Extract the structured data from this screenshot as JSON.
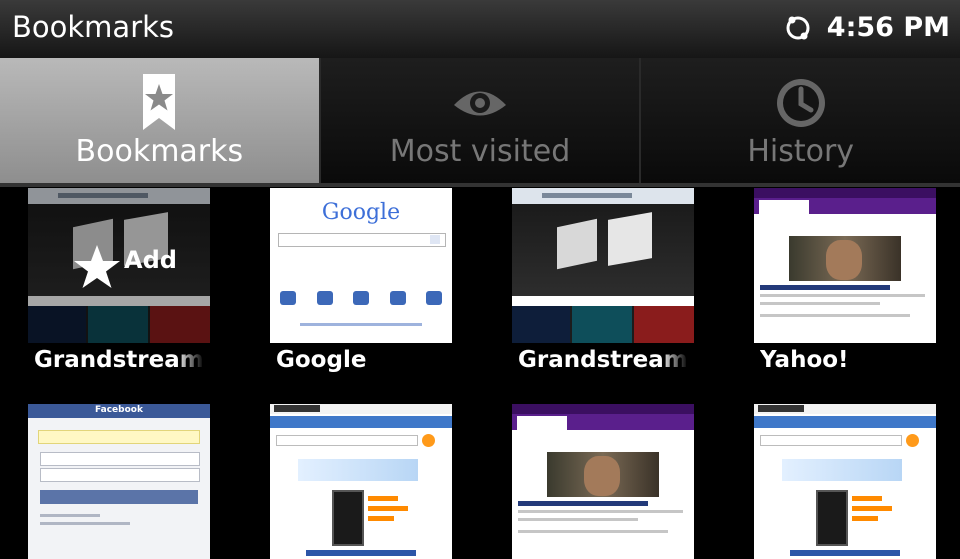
{
  "status_bar": {
    "title": "Bookmarks",
    "time": "4:56 PM",
    "sync_icon": "sync-icon"
  },
  "tabs": [
    {
      "label": "Bookmarks",
      "icon": "bookmark-star-icon",
      "selected": true
    },
    {
      "label": "Most visited",
      "icon": "eye-icon",
      "selected": false
    },
    {
      "label": "History",
      "icon": "clock-icon",
      "selected": false
    }
  ],
  "add_label": "Add",
  "bookmarks": [
    {
      "title": "Grandstream Networks",
      "thumb": "grandstream"
    },
    {
      "title": "Google",
      "thumb": "google",
      "logo_text": "Google"
    },
    {
      "title": "Grandstream Networks",
      "thumb": "grandstream"
    },
    {
      "title": "Yahoo!",
      "thumb": "yahoo"
    },
    {
      "title": "",
      "thumb": "facebook",
      "logo_text": "Facebook"
    },
    {
      "title": "",
      "thumb": "amazon"
    },
    {
      "title": "",
      "thumb": "yahoo"
    },
    {
      "title": "",
      "thumb": "amazon"
    }
  ],
  "colors": {
    "selected_tab": "#a3a3a3",
    "facebook_blue": "#3b5998",
    "yahoo_purple": "#5a1f8c",
    "google_blue": "#3d6fd8"
  }
}
